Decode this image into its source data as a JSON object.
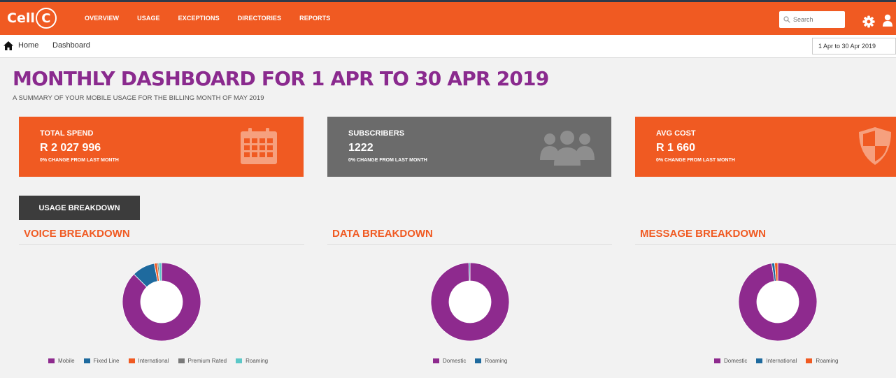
{
  "header": {
    "logo_text": "Cell",
    "logo_c": "C",
    "nav": [
      "OVERVIEW",
      "USAGE",
      "EXCEPTIONS",
      "DIRECTORIES",
      "REPORTS"
    ],
    "search_placeholder": "Search"
  },
  "breadcrumb": {
    "home": "Home",
    "current": "Dashboard"
  },
  "date_range": "1 Apr to 30 Apr 2019",
  "page": {
    "title": "MONTHLY DASHBOARD FOR 1 APR TO 30 APR 2019",
    "subtitle": "A SUMMARY OF YOUR MOBILE USAGE FOR THE BILLING MONTH OF MAY 2019"
  },
  "cards": [
    {
      "label": "TOTAL SPEND",
      "value": "R 2 027 996",
      "change": "0% CHANGE FROM LAST MONTH",
      "icon": "calendar-icon"
    },
    {
      "label": "SUBSCRIBERS",
      "value": "1222",
      "change": "0% CHANGE FROM LAST MONTH",
      "icon": "users-icon"
    },
    {
      "label": "AVG COST",
      "value": "R 1 660",
      "change": "0% CHANGE FROM LAST MONTH",
      "icon": "shield-icon"
    }
  ],
  "usage_button": "USAGE BREAKDOWN",
  "colors": {
    "brand_orange": "#f05a22",
    "purple": "#8e2a8e",
    "blue": "#1e6a9e",
    "orange": "#f05a22",
    "grey": "#7a7a7a",
    "teal": "#5cc8c8"
  },
  "chart_data": [
    {
      "type": "pie",
      "title": "VOICE BREAKDOWN",
      "categories": [
        "Mobile",
        "Fixed Line",
        "International",
        "Premium Rated",
        "Roaming"
      ],
      "values": [
        87.5,
        9.5,
        1.2,
        0.6,
        1.2
      ],
      "colors": [
        "#8e2a8e",
        "#1e6a9e",
        "#f05a22",
        "#7a7a7a",
        "#5cc8c8"
      ]
    },
    {
      "type": "pie",
      "title": "DATA BREAKDOWN",
      "categories": [
        "Domestic",
        "Roaming"
      ],
      "values": [
        99.5,
        0.5
      ],
      "colors": [
        "#8e2a8e",
        "#1e6a9e"
      ]
    },
    {
      "type": "pie",
      "title": "MESSAGE BREAKDOWN",
      "categories": [
        "Domestic",
        "International",
        "Roaming"
      ],
      "values": [
        97.5,
        1.2,
        1.3
      ],
      "colors": [
        "#8e2a8e",
        "#1e6a9e",
        "#f05a22"
      ]
    }
  ]
}
